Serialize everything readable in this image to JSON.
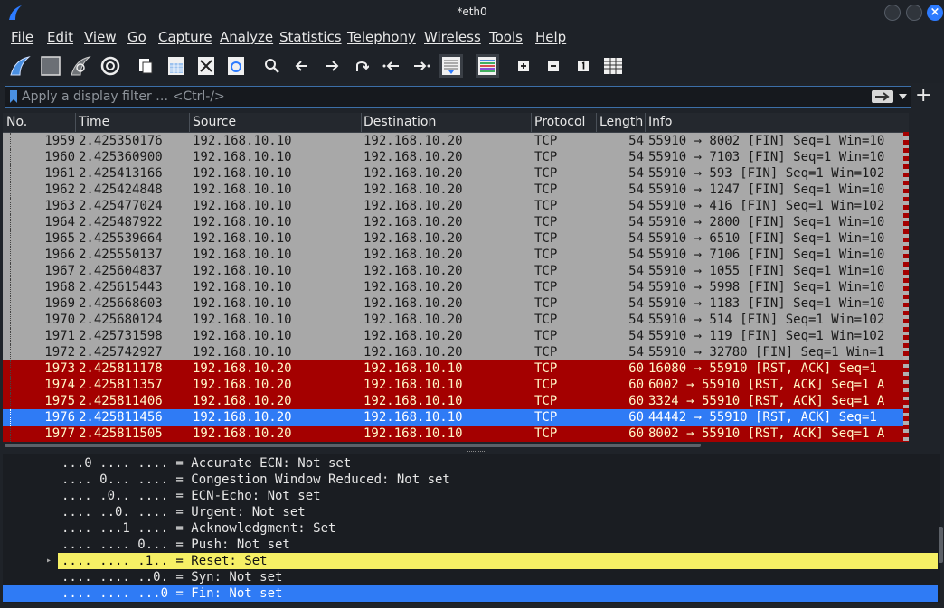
{
  "window": {
    "title": "*eth0",
    "close_glyph": "×"
  },
  "menu": [
    "File",
    "Edit",
    "View",
    "Go",
    "Capture",
    "Analyze",
    "Statistics",
    "Telephony",
    "Wireless",
    "Tools",
    "Help"
  ],
  "toolbar_icons": [
    "shark-fin-start-icon",
    "stop-capture-icon",
    "restart-capture-icon",
    "capture-options-gear-icon",
    "open-file-icon",
    "save-file-icon",
    "close-file-icon",
    "reload-file-icon",
    "find-packet-icon",
    "go-back-icon",
    "go-forward-icon",
    "go-to-packet-icon",
    "first-packet-icon",
    "last-packet-icon",
    "autoscroll-icon",
    "colorize-icon",
    "zoom-in-icon",
    "zoom-out-icon",
    "normal-size-icon",
    "resize-columns-icon"
  ],
  "filter": {
    "placeholder": "Apply a display filter … <Ctrl-/>",
    "plus": "+"
  },
  "columns": [
    "No.",
    "Time",
    "Source",
    "Destination",
    "Protocol",
    "Length",
    "Info"
  ],
  "packets": [
    {
      "no": "1959",
      "time": "2.425350176",
      "src": "192.168.10.10",
      "dst": "192.168.10.20",
      "proto": "TCP",
      "len": "54",
      "info": "55910 → 8002 [FIN] Seq=1 Win=10",
      "style": "grey"
    },
    {
      "no": "1960",
      "time": "2.425360900",
      "src": "192.168.10.10",
      "dst": "192.168.10.20",
      "proto": "TCP",
      "len": "54",
      "info": "55910 → 7103 [FIN] Seq=1 Win=10",
      "style": "grey"
    },
    {
      "no": "1961",
      "time": "2.425413166",
      "src": "192.168.10.10",
      "dst": "192.168.10.20",
      "proto": "TCP",
      "len": "54",
      "info": "55910 → 593 [FIN] Seq=1 Win=102",
      "style": "grey"
    },
    {
      "no": "1962",
      "time": "2.425424848",
      "src": "192.168.10.10",
      "dst": "192.168.10.20",
      "proto": "TCP",
      "len": "54",
      "info": "55910 → 1247 [FIN] Seq=1 Win=10",
      "style": "grey"
    },
    {
      "no": "1963",
      "time": "2.425477024",
      "src": "192.168.10.10",
      "dst": "192.168.10.20",
      "proto": "TCP",
      "len": "54",
      "info": "55910 → 416 [FIN] Seq=1 Win=102",
      "style": "grey"
    },
    {
      "no": "1964",
      "time": "2.425487922",
      "src": "192.168.10.10",
      "dst": "192.168.10.20",
      "proto": "TCP",
      "len": "54",
      "info": "55910 → 2800 [FIN] Seq=1 Win=10",
      "style": "grey"
    },
    {
      "no": "1965",
      "time": "2.425539664",
      "src": "192.168.10.10",
      "dst": "192.168.10.20",
      "proto": "TCP",
      "len": "54",
      "info": "55910 → 6510 [FIN] Seq=1 Win=10",
      "style": "grey"
    },
    {
      "no": "1966",
      "time": "2.425550137",
      "src": "192.168.10.10",
      "dst": "192.168.10.20",
      "proto": "TCP",
      "len": "54",
      "info": "55910 → 7106 [FIN] Seq=1 Win=10",
      "style": "grey"
    },
    {
      "no": "1967",
      "time": "2.425604837",
      "src": "192.168.10.10",
      "dst": "192.168.10.20",
      "proto": "TCP",
      "len": "54",
      "info": "55910 → 1055 [FIN] Seq=1 Win=10",
      "style": "grey"
    },
    {
      "no": "1968",
      "time": "2.425615443",
      "src": "192.168.10.10",
      "dst": "192.168.10.20",
      "proto": "TCP",
      "len": "54",
      "info": "55910 → 5998 [FIN] Seq=1 Win=10",
      "style": "grey"
    },
    {
      "no": "1969",
      "time": "2.425668603",
      "src": "192.168.10.10",
      "dst": "192.168.10.20",
      "proto": "TCP",
      "len": "54",
      "info": "55910 → 1183 [FIN] Seq=1 Win=10",
      "style": "grey"
    },
    {
      "no": "1970",
      "time": "2.425680124",
      "src": "192.168.10.10",
      "dst": "192.168.10.20",
      "proto": "TCP",
      "len": "54",
      "info": "55910 → 514 [FIN] Seq=1 Win=102",
      "style": "grey"
    },
    {
      "no": "1971",
      "time": "2.425731598",
      "src": "192.168.10.10",
      "dst": "192.168.10.20",
      "proto": "TCP",
      "len": "54",
      "info": "55910 → 119 [FIN] Seq=1 Win=102",
      "style": "grey"
    },
    {
      "no": "1972",
      "time": "2.425742927",
      "src": "192.168.10.10",
      "dst": "192.168.10.20",
      "proto": "TCP",
      "len": "54",
      "info": "55910 → 32780 [FIN] Seq=1 Win=1",
      "style": "grey"
    },
    {
      "no": "1973",
      "time": "2.425811178",
      "src": "192.168.10.20",
      "dst": "192.168.10.10",
      "proto": "TCP",
      "len": "60",
      "info": "16080 → 55910 [RST, ACK] Seq=1",
      "style": "red"
    },
    {
      "no": "1974",
      "time": "2.425811357",
      "src": "192.168.10.20",
      "dst": "192.168.10.10",
      "proto": "TCP",
      "len": "60",
      "info": "6002 → 55910 [RST, ACK] Seq=1 A",
      "style": "red"
    },
    {
      "no": "1975",
      "time": "2.425811406",
      "src": "192.168.10.20",
      "dst": "192.168.10.10",
      "proto": "TCP",
      "len": "60",
      "info": "3324 → 55910 [RST, ACK] Seq=1 A",
      "style": "red"
    },
    {
      "no": "1976",
      "time": "2.425811456",
      "src": "192.168.10.20",
      "dst": "192.168.10.10",
      "proto": "TCP",
      "len": "60",
      "info": "44442 → 55910 [RST, ACK] Seq=1",
      "style": "sel"
    },
    {
      "no": "1977",
      "time": "2.425811505",
      "src": "192.168.10.20",
      "dst": "192.168.10.10",
      "proto": "TCP",
      "len": "60",
      "info": "8002 → 55910 [RST, ACK] Seq=1 A",
      "style": "red"
    }
  ],
  "details": [
    {
      "text": "...0 .... .... = Accurate ECN: Not set",
      "style": ""
    },
    {
      "text": ".... 0... .... = Congestion Window Reduced: Not set",
      "style": ""
    },
    {
      "text": ".... .0.. .... = ECN-Echo: Not set",
      "style": ""
    },
    {
      "text": ".... ..0. .... = Urgent: Not set",
      "style": ""
    },
    {
      "text": ".... ...1 .... = Acknowledgment: Set",
      "style": ""
    },
    {
      "text": ".... .... 0... = Push: Not set",
      "style": ""
    },
    {
      "text": ".... .... .1.. = Reset: Set",
      "style": "yellow"
    },
    {
      "text": ".... .... ..0. = Syn: Not set",
      "style": ""
    },
    {
      "text": ".... .... ...0 = Fin: Not set",
      "style": "blue"
    }
  ],
  "colors": {
    "red_row": "#a40000",
    "selected_row": "#2f7bf5",
    "grey_row": "#a8a8a8",
    "highlight_yellow": "#f6f065"
  }
}
